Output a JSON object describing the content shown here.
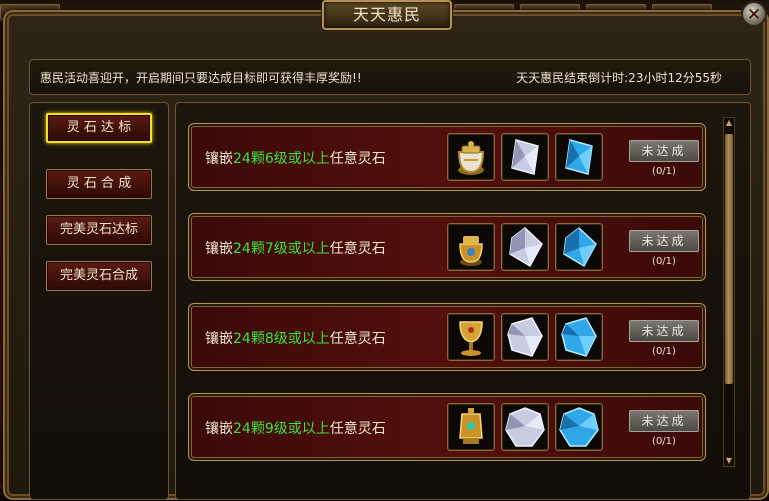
{
  "window": {
    "title": "天天惠民",
    "close_icon": "close-icon"
  },
  "notice": {
    "message": "惠民活动喜迎开，开启期间只要达成目标即可获得丰厚奖励!!",
    "countdown": "天天惠民结束倒计时:23小时12分55秒"
  },
  "nav": {
    "items": [
      {
        "label": "灵 石  达 标",
        "active": true
      },
      {
        "label": "灵 石  合 成",
        "active": false
      },
      {
        "label": "完美灵石达标",
        "active": false
      },
      {
        "label": "完美灵石合成",
        "active": false
      }
    ]
  },
  "tasks": [
    {
      "prefix": "镶嵌",
      "highlight": "24颗6级或以上",
      "suffix": "任意灵石",
      "rewards": [
        "white-gold-jar-icon",
        "white-gem-icon",
        "blue-gem-icon"
      ],
      "status": "未达成",
      "progress": "(0/1)"
    },
    {
      "prefix": "镶嵌",
      "highlight": "24颗7级或以上",
      "suffix": "任意灵石",
      "rewards": [
        "gold-jar-icon",
        "white-gem-icon",
        "blue-gem-icon"
      ],
      "status": "未达成",
      "progress": "(0/1)"
    },
    {
      "prefix": "镶嵌",
      "highlight": "24颗8级或以上",
      "suffix": "任意灵石",
      "rewards": [
        "gold-goblet-icon",
        "white-gem-icon",
        "blue-gem-icon"
      ],
      "status": "未达成",
      "progress": "(0/1)"
    },
    {
      "prefix": "镶嵌",
      "highlight": "24颗9级或以上",
      "suffix": "任意灵石",
      "rewards": [
        "gold-lantern-icon",
        "white-gem-icon",
        "blue-gem-icon"
      ],
      "status": "未达成",
      "progress": "(0/1)"
    }
  ],
  "colors": {
    "highlight_green": "#3fe03f",
    "active_border": "#f4e02a",
    "gem_white": "#cfd3e6",
    "gem_blue": "#2fa7e8",
    "gold": "#d4a334"
  }
}
